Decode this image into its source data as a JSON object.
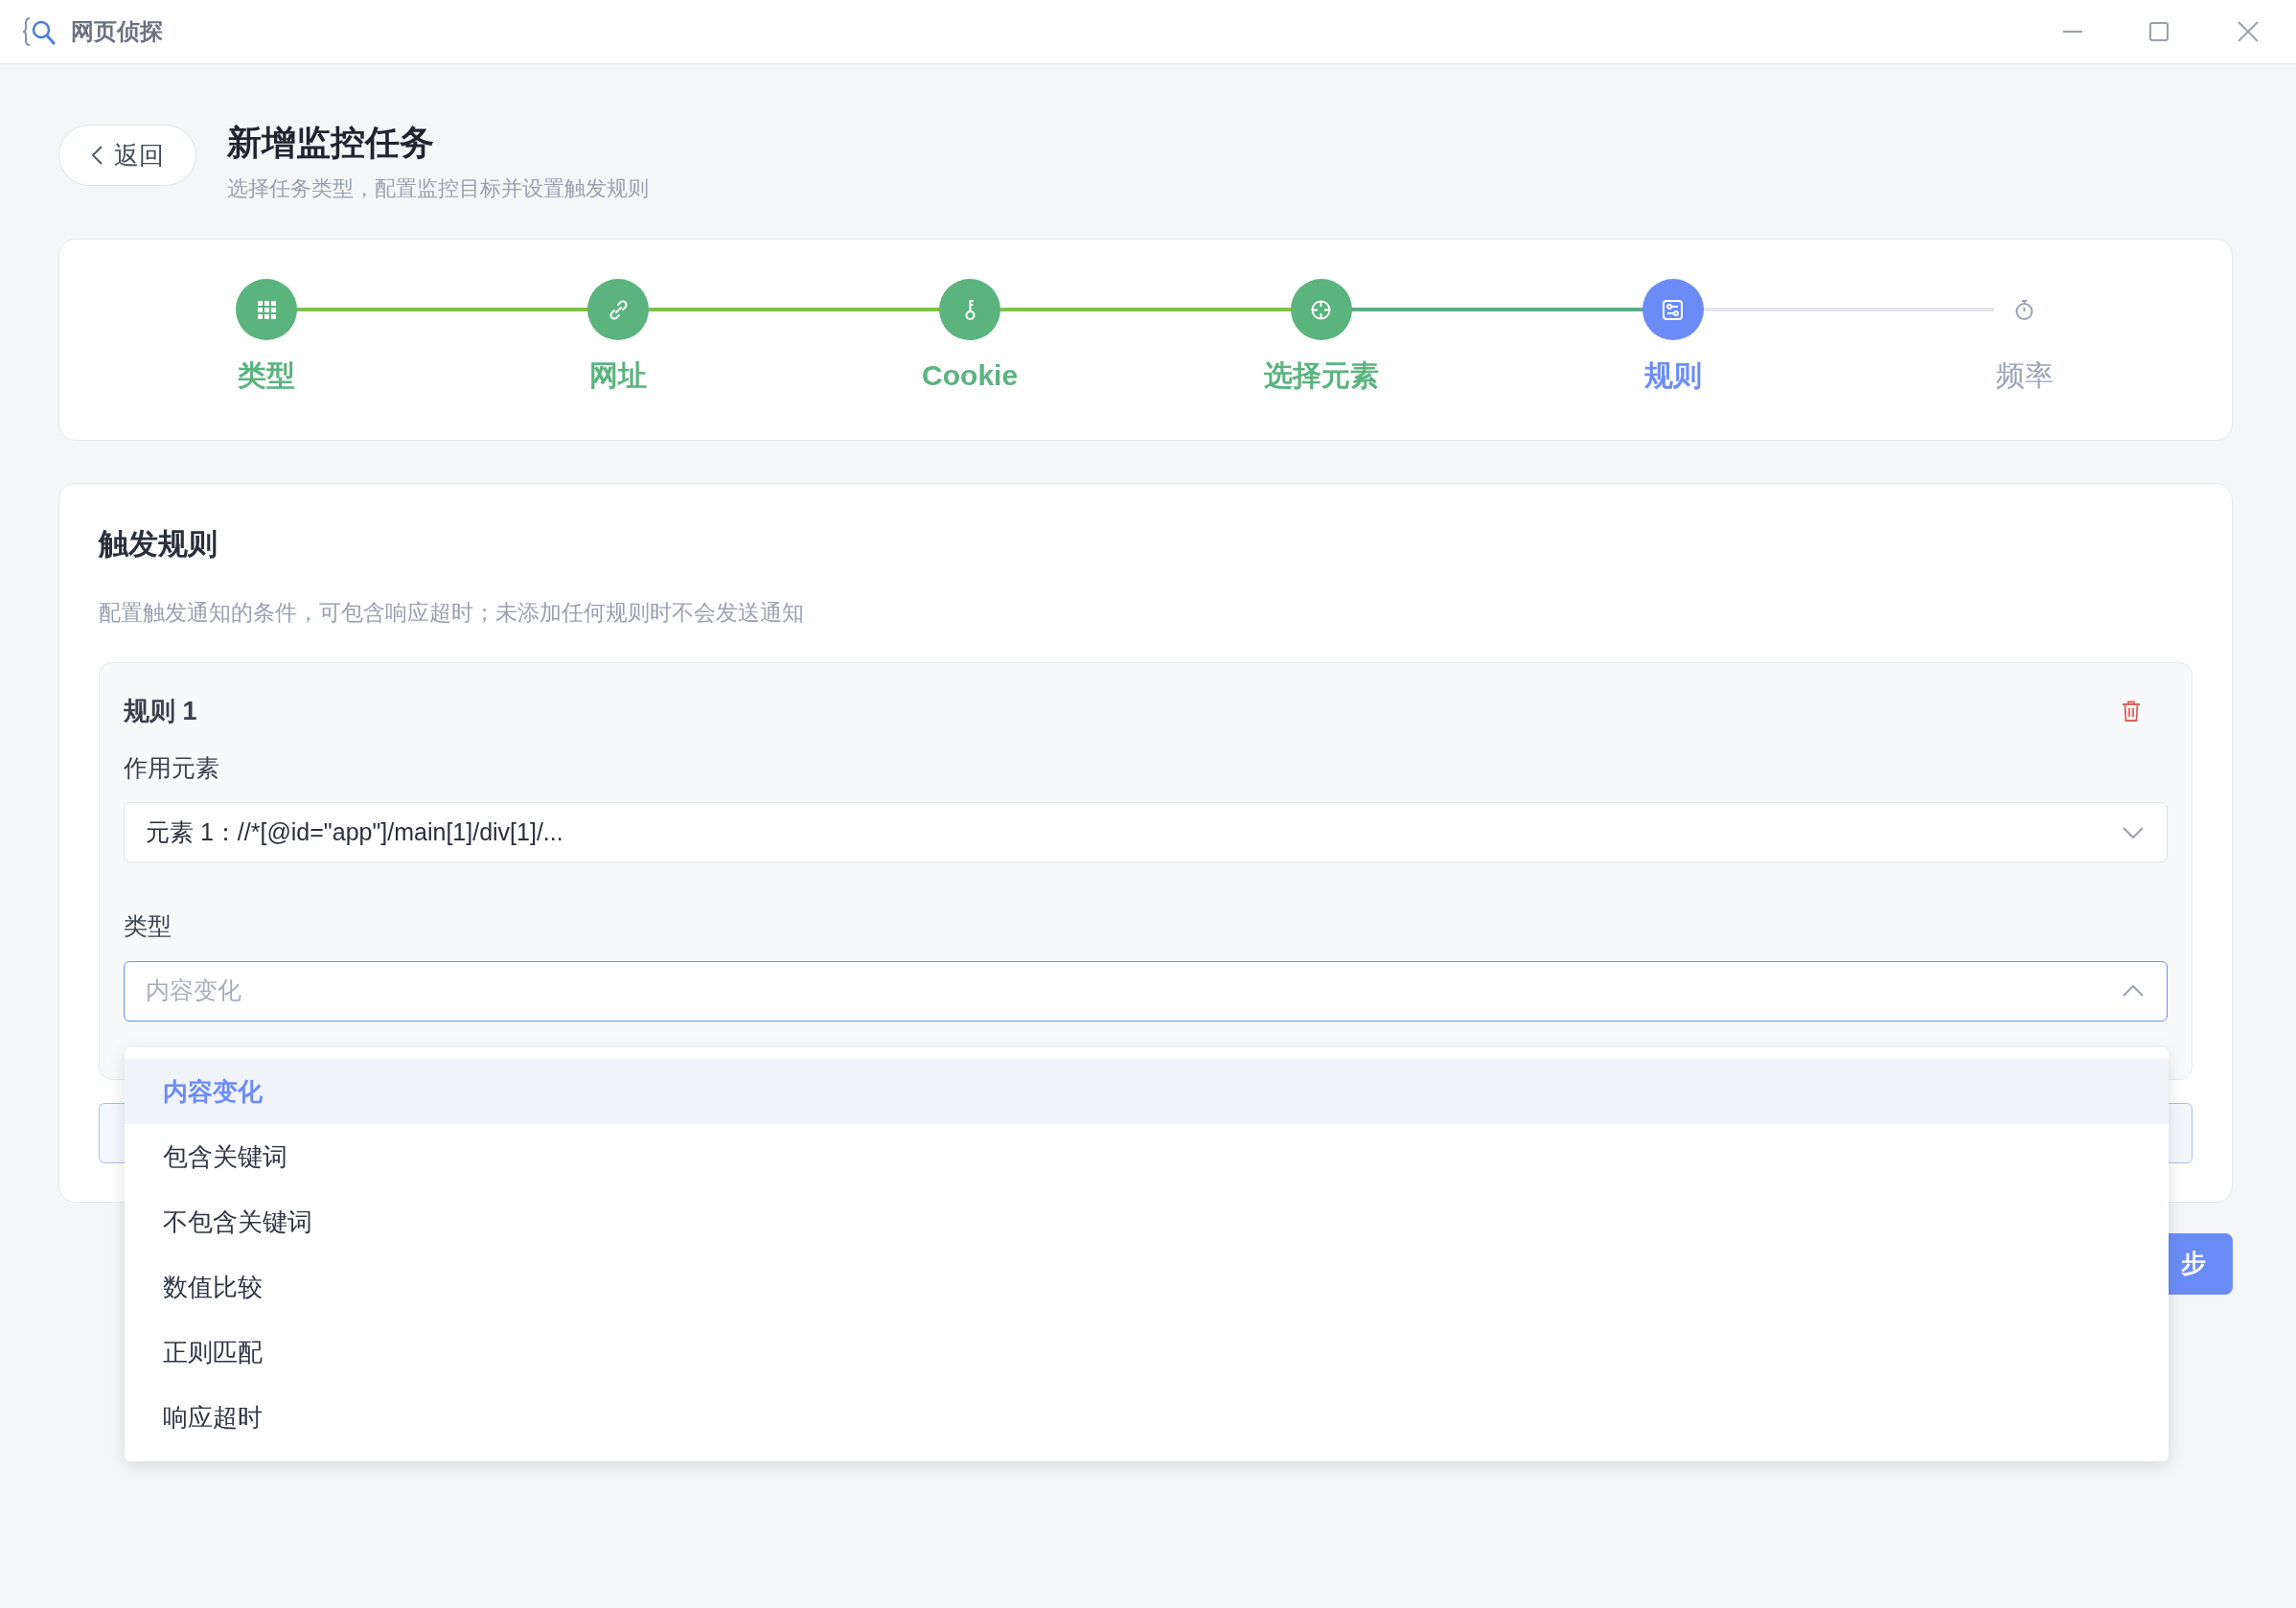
{
  "window": {
    "title": "网页侦探"
  },
  "header": {
    "back": "返回",
    "title": "新增监控任务",
    "subtitle": "选择任务类型，配置监控目标并设置触发规则"
  },
  "steps": [
    {
      "label": "类型",
      "completed": true,
      "selected": false
    },
    {
      "label": "网址",
      "completed": true,
      "selected": false
    },
    {
      "label": "Cookie",
      "completed": true,
      "selected": false
    },
    {
      "label": "选择元素",
      "completed": true,
      "selected": false
    },
    {
      "label": "规则",
      "completed": false,
      "selected": true
    },
    {
      "label": "频率",
      "completed": false,
      "selected": false
    }
  ],
  "rules_section": {
    "title": "触发规则",
    "description": "配置触发通知的条件，可包含响应超时；未添加任何规则时不会发送通知",
    "rule": {
      "title": "规则 1",
      "element_field": {
        "label": "作用元素",
        "value": "元素 1：//*[@id=\"app\"]/main[1]/div[1]/..."
      },
      "type_field": {
        "label": "类型",
        "placeholder": "内容变化",
        "expanded": true
      }
    }
  },
  "dropdown": [
    {
      "label": "内容变化",
      "selected": true
    },
    {
      "label": "包含关键词",
      "selected": false
    },
    {
      "label": "不包含关键词",
      "selected": false
    },
    {
      "label": "数值比较",
      "selected": false
    },
    {
      "label": "正则匹配",
      "selected": false
    },
    {
      "label": "响应超时",
      "selected": false
    }
  ],
  "next_button": "步"
}
